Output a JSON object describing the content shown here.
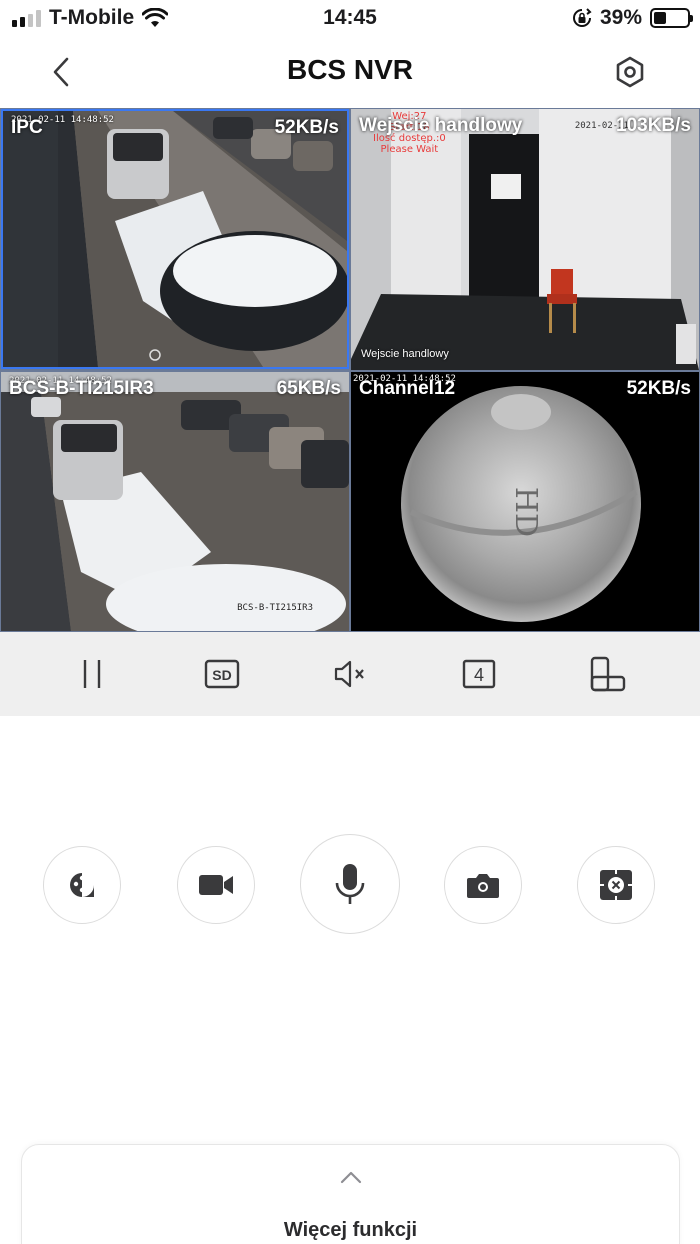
{
  "status_bar": {
    "carrier": "T-Mobile",
    "time": "14:45",
    "battery_percent": "39%",
    "battery_level": 0.39,
    "signal_bars": 2
  },
  "nav": {
    "title": "BCS NVR",
    "back_icon": "chevron-left-icon",
    "settings_icon": "hexagon-gear-icon"
  },
  "channels": [
    {
      "name": "IPC",
      "rate": "52KB/s",
      "osd": "2021-02-11 14:48:52",
      "selected": true
    },
    {
      "name": "Wejscie handlowy",
      "rate": "103KB/s",
      "osd": "2021-02-11",
      "overlay_lines": [
        "Wej:27",
        "Start:18",
        "Ilość dostęp.:0",
        "Please Wait"
      ],
      "caption": "Wejscie handlowy"
    },
    {
      "name": "BCS-B-TI215IR3",
      "rate": "65KB/s",
      "osd": "2021-02-11 14:48:52",
      "corner_label": "BCS-B-TI215IR3"
    },
    {
      "name": "Channel12",
      "rate": "52KB/s",
      "osd": "2021-02-11 14:48:52",
      "lens_text": "HD"
    }
  ],
  "controls": {
    "pause_icon": "pause-icon",
    "quality_label": "SD",
    "mute_icon": "speaker-muted-icon",
    "split_label": "4",
    "orientation_icon": "rotate-screen-icon"
  },
  "actions": [
    {
      "name": "ptz",
      "icon": "ptz-dial-icon"
    },
    {
      "name": "record",
      "icon": "video-camera-icon"
    },
    {
      "name": "talk",
      "icon": "microphone-icon"
    },
    {
      "name": "snapshot",
      "icon": "camera-icon"
    },
    {
      "name": "fisheye",
      "icon": "fisheye-close-icon"
    }
  ],
  "more": {
    "label": "Więcej funkcji",
    "icon": "chevron-up-icon"
  },
  "colors": {
    "selected_border": "#3a78f2",
    "control_strip_bg": "#efefef",
    "osd_red": "#e83b3b",
    "icon": "#3a3a3c"
  }
}
